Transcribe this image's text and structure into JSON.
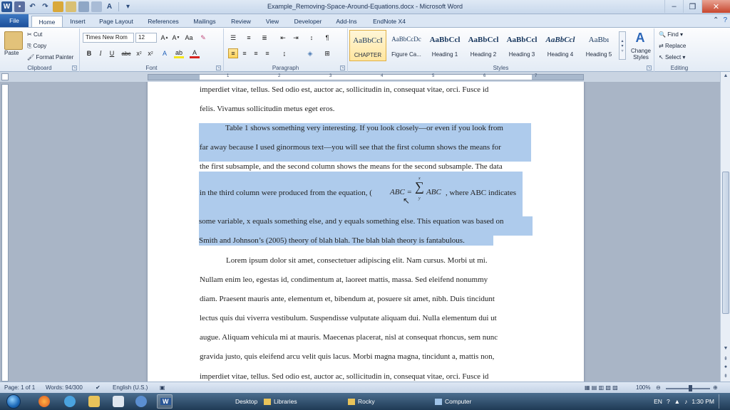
{
  "window": {
    "title": "Example_Removing-Space-Around-Equations.docx - Microsoft Word",
    "app_letter": "W"
  },
  "tabs": [
    "File",
    "Home",
    "Insert",
    "Page Layout",
    "References",
    "Mailings",
    "Review",
    "View",
    "Developer",
    "Add-Ins",
    "EndNote X4"
  ],
  "clipboard": {
    "paste": "Paste",
    "cut": "Cut",
    "copy": "Copy",
    "format_painter": "Format Painter",
    "label": "Clipboard"
  },
  "font": {
    "name": "Times New Rom",
    "size": "12",
    "label": "Font"
  },
  "paragraph": {
    "label": "Paragraph"
  },
  "styles": {
    "items": [
      {
        "sample": "AaBbCcI",
        "name": "CHAPTER"
      },
      {
        "sample": "AaBbCcDc",
        "name": "Figure Ca..."
      },
      {
        "sample": "AaBbCcl",
        "name": "Heading 1"
      },
      {
        "sample": "AaBbCcl",
        "name": "Heading 2"
      },
      {
        "sample": "AaBbCcl",
        "name": "Heading 3"
      },
      {
        "sample": "AaBbCcl",
        "name": "Heading 4"
      },
      {
        "sample": "AaBbı",
        "name": "Heading 5"
      }
    ],
    "change_styles": "Change Styles",
    "label": "Styles"
  },
  "editing": {
    "find": "Find",
    "replace": "Replace",
    "select": "Select",
    "label": "Editing"
  },
  "document": {
    "lines_before": [
      "imperdiet vitae, tellus. Sed odio est, auctor ac, sollicitudin in, consequat vitae, orci. Fusce id",
      "felis. Vivamus sollicitudin metus eget eros."
    ],
    "selected_lines": [
      "Table 1 shows something very interesting. If you look closely—or even if you look from",
      "far away because I used ginormous text—you will see that the first column shows the means for",
      "the first subsample, and the second column shows the means for the second subsample. The data",
      "in the third column were produced from the equation, (",
      "some variable, x equals something else, and y equals something else. This equation was based on",
      "Smith and Johnson’s (2005) theory of blah blah. The blah blah theory is fantabulous."
    ],
    "equation": {
      "lhs": "ABC =",
      "sum": "∑",
      "sum_top": "x",
      "sum_bottom": "y",
      "rhs": "ABC",
      "after": ", where ABC indicates"
    },
    "lines_after": [
      "Lorem ipsum dolor sit amet, consectetuer adipiscing elit. Nam cursus. Morbi ut mi.",
      "Nullam enim leo, egestas id, condimentum at, laoreet mattis, massa. Sed eleifend nonummy",
      "diam. Praesent mauris ante, elementum et, bibendum at, posuere sit amet, nibh. Duis tincidunt",
      "lectus quis dui viverra vestibulum. Suspendisse vulputate aliquam dui. Nulla elementum dui ut",
      "augue. Aliquam vehicula mi at mauris. Maecenas placerat, nisl at consequat rhoncus, sem nunc",
      "gravida justo, quis eleifend arcu velit quis lacus. Morbi magna magna, tincidunt a, mattis non,",
      "imperdiet vitae, tellus. Sed odio est, auctor ac, sollicitudin in, consequat vitae, orci. Fusce id"
    ]
  },
  "status": {
    "page": "Page: 1 of 1",
    "words": "Words: 94/300",
    "language": "English (U.S.)",
    "zoom": "100%"
  },
  "taskbar": {
    "desktop": "Desktop",
    "libraries": "Libraries",
    "rocky": "Rocky",
    "computer": "Computer",
    "lang": "EN",
    "time": "1:30 PM"
  },
  "colors": {
    "selection": "#aecbec",
    "file_tab": "#2a62ad",
    "ribbon": "#e3ebf5"
  }
}
